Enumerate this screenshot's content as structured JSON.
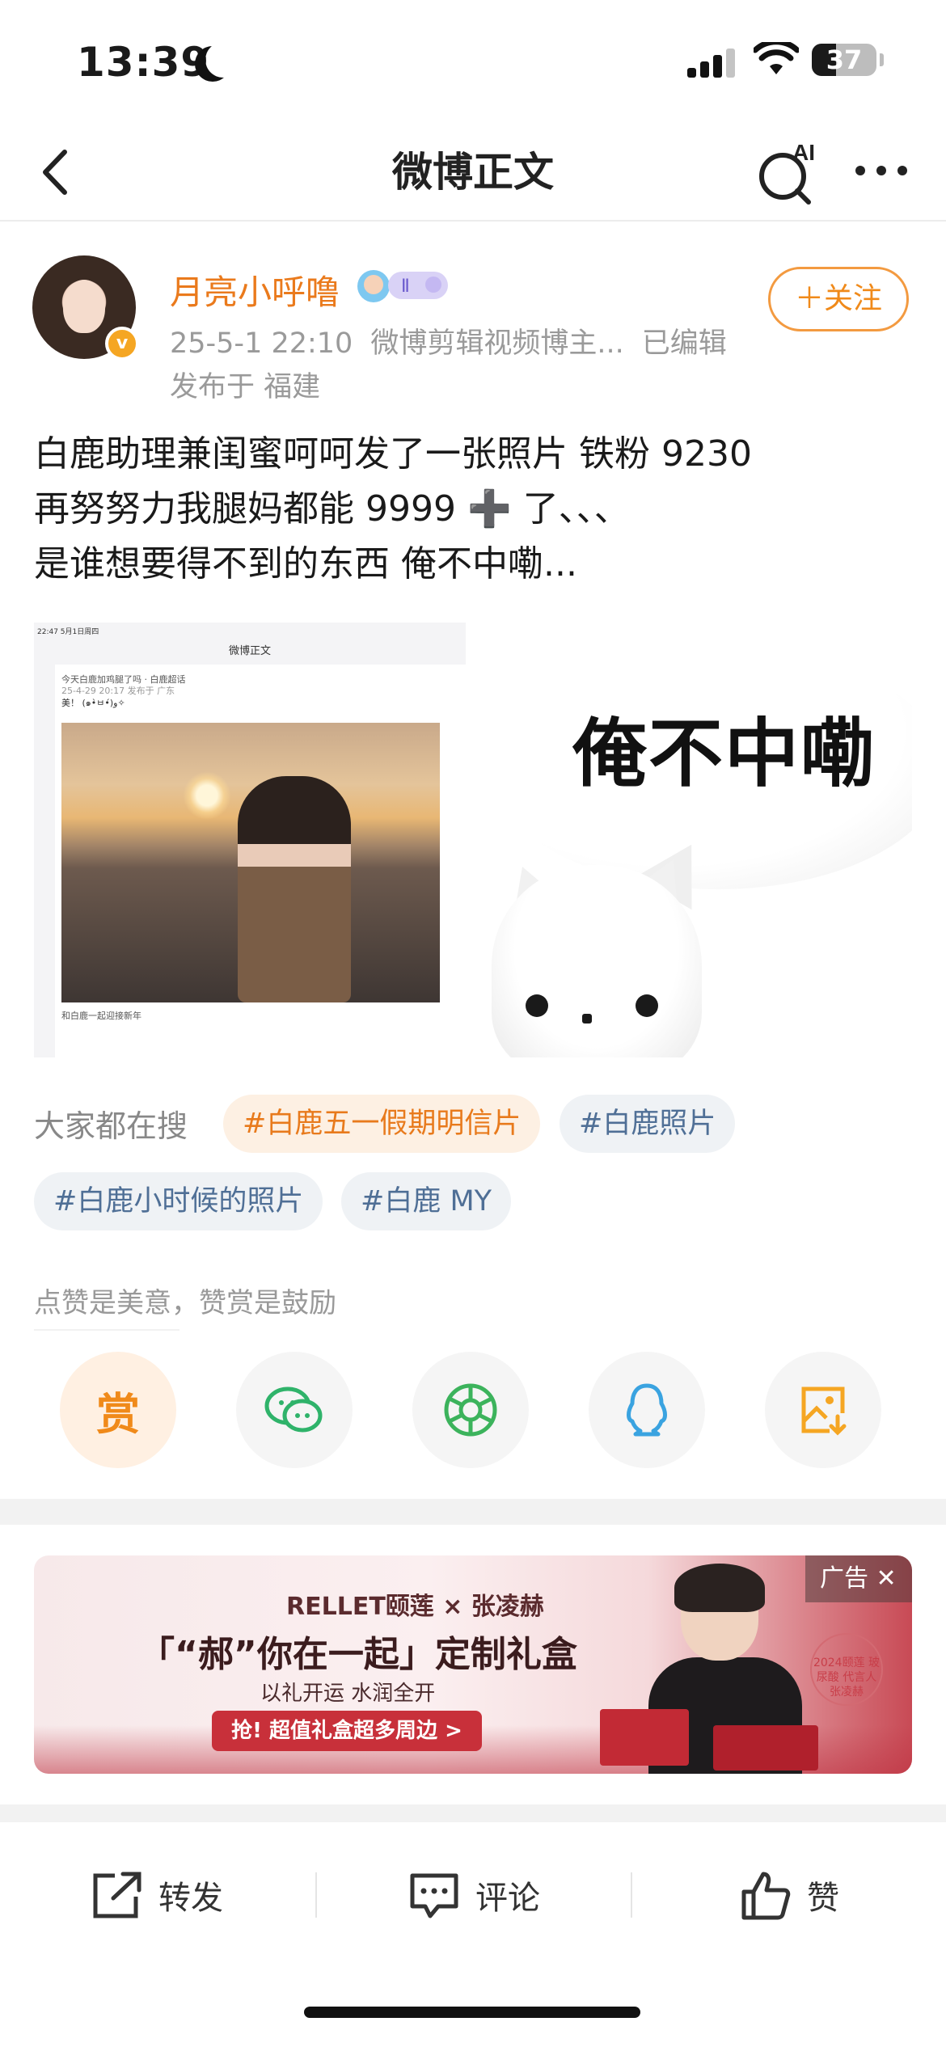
{
  "status_bar": {
    "time": "13:39",
    "battery": "37",
    "battery_level": 0.37,
    "icons": [
      "moon-icon",
      "signal-icon",
      "wifi-icon",
      "battery-icon"
    ]
  },
  "nav": {
    "title": "微博正文",
    "ai_label": "AI",
    "icons": [
      "back-icon",
      "ai-search-icon",
      "more-icon"
    ]
  },
  "post": {
    "username": "月亮小呼噜",
    "verified_mark": "v",
    "date": "25-5-1 22:10",
    "source": "微博剪辑视频博主...",
    "edited": "已编辑",
    "location": "发布于 福建",
    "follow_label": "＋关注",
    "text_lines": [
      "白鹿助理兼闺蜜呵呵发了一张照片  铁粉 9230",
      "再努努力我腿妈都能 9999 ➕ 了、、、",
      "是谁想要得不到的东西  俺不中嘞..."
    ],
    "image_1": {
      "status": "22:47  5月1日周四",
      "title": "微博正文",
      "post_user": "今天白鹿加鸡腿了吗  ·  白鹿超话",
      "post_meta": "25-4-29 20:17  发布于 广东",
      "post_text": "美！ (๑•̀ㅂ•́)و✧",
      "footer": "和白鹿一起迎接新年"
    },
    "image_2": {
      "meme_text": "俺不中嘞"
    }
  },
  "trending": {
    "label": "大家都在搜",
    "tags": [
      "#白鹿五一假期明信片",
      "#白鹿照片",
      "#白鹿小时候的照片",
      "#白鹿 MY"
    ]
  },
  "reward": {
    "caption": "点赞是美意，赞赏是鼓励",
    "reward_label": "赏",
    "share_targets": [
      "wechat-icon",
      "moments-icon",
      "qq-icon",
      "save-image-icon"
    ]
  },
  "ad": {
    "badge": "广告 ✕",
    "brand": "RELLET颐莲 × 张凌赫",
    "headline": "「“郝”你在一起」定制礼盒",
    "subline": "以礼开运  水润全开",
    "cta": "抢! 超值礼盒超多周边 >",
    "seal": "2024颐莲 玻尿酸 代言人 张凌赫"
  },
  "toolbar": {
    "repost": "转发",
    "comment": "评论",
    "like": "赞"
  },
  "colors": {
    "accent_orange": "#ea7a1c",
    "tag_blue": "#4f6f96",
    "wechat_green": "#2fb36a",
    "qq_blue": "#3aa3e0",
    "save_orange": "#f5a623"
  }
}
